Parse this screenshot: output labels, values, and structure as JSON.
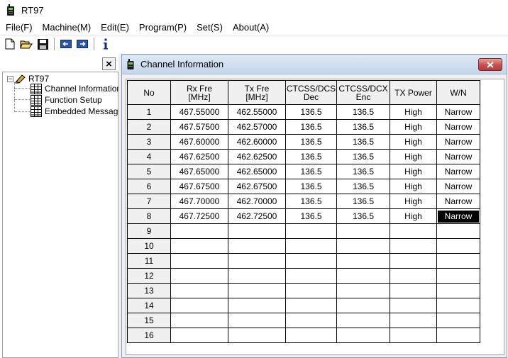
{
  "app": {
    "title": "RT97"
  },
  "menu": [
    {
      "label": "File(F)"
    },
    {
      "label": "Machine(M)"
    },
    {
      "label": "Edit(E)"
    },
    {
      "label": "Program(P)"
    },
    {
      "label": "Set(S)"
    },
    {
      "label": "About(A)"
    }
  ],
  "toolbar": {
    "buttons": [
      "new-file-icon",
      "open-folder-icon",
      "save-disk-icon",
      "read-from-radio-icon",
      "write-to-radio-icon",
      "info-icon"
    ]
  },
  "tree": {
    "root": "RT97",
    "items": [
      {
        "label": "Channel Information"
      },
      {
        "label": "Function Setup"
      },
      {
        "label": "Embedded Message"
      }
    ]
  },
  "left_panel": {
    "close_glyph": "×"
  },
  "child_window": {
    "title": "Channel Information"
  },
  "table": {
    "headers": [
      "No",
      "Rx Fre\n[MHz]",
      "Tx Fre\n[MHz]",
      "CTCSS/DCS\nDec",
      "CTCSS/DCX\nEnc",
      "TX Power",
      "W/N"
    ],
    "rows": [
      [
        "1",
        "467.55000",
        "462.55000",
        "136.5",
        "136.5",
        "High",
        "Narrow"
      ],
      [
        "2",
        "467.57500",
        "462.57000",
        "136.5",
        "136.5",
        "High",
        "Narrow"
      ],
      [
        "3",
        "467.60000",
        "462.60000",
        "136.5",
        "136.5",
        "High",
        "Narrow"
      ],
      [
        "4",
        "467.62500",
        "462.62500",
        "136.5",
        "136.5",
        "High",
        "Narrow"
      ],
      [
        "5",
        "467.65000",
        "462.65000",
        "136.5",
        "136.5",
        "High",
        "Narrow"
      ],
      [
        "6",
        "467.67500",
        "462.67500",
        "136.5",
        "136.5",
        "High",
        "Narrow"
      ],
      [
        "7",
        "467.70000",
        "462.70000",
        "136.5",
        "136.5",
        "High",
        "Narrow"
      ],
      [
        "8",
        "467.72500",
        "462.72500",
        "136.5",
        "136.5",
        "High",
        "Narrow"
      ],
      [
        "9",
        "",
        "",
        "",
        "",
        "",
        ""
      ],
      [
        "10",
        "",
        "",
        "",
        "",
        "",
        ""
      ],
      [
        "11",
        "",
        "",
        "",
        "",
        "",
        ""
      ],
      [
        "12",
        "",
        "",
        "",
        "",
        "",
        ""
      ],
      [
        "13",
        "",
        "",
        "",
        "",
        "",
        ""
      ],
      [
        "14",
        "",
        "",
        "",
        "",
        "",
        ""
      ],
      [
        "15",
        "",
        "",
        "",
        "",
        "",
        ""
      ],
      [
        "16",
        "",
        "",
        "",
        "",
        "",
        ""
      ]
    ],
    "selected": {
      "row": 7,
      "col": 6
    }
  }
}
